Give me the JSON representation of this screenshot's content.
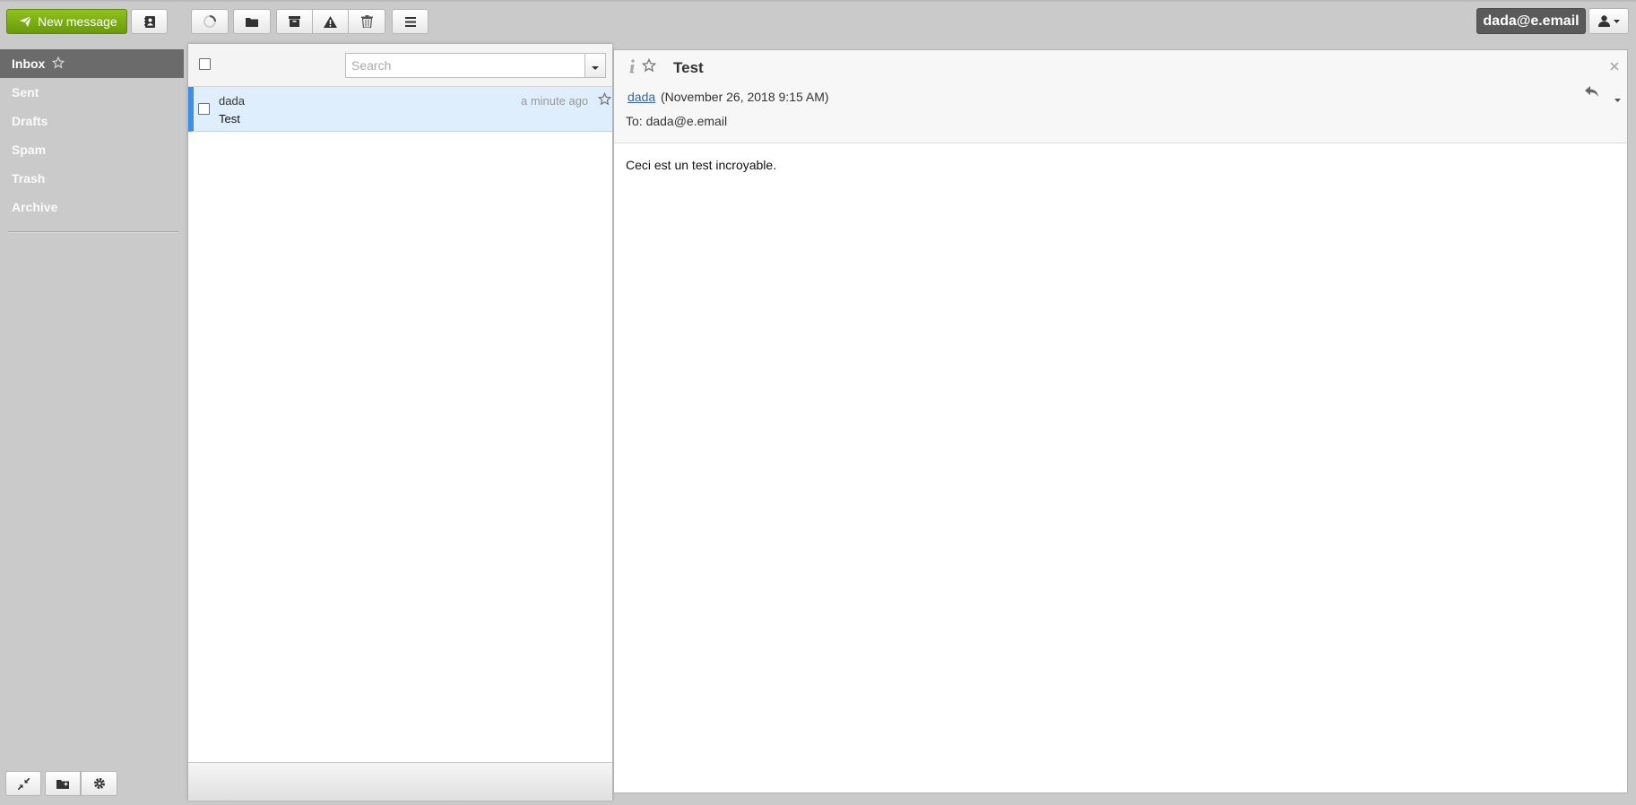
{
  "toolbar": {
    "new_message_label": "New message",
    "user_email": "dada@e.email"
  },
  "folders": [
    {
      "label": "Inbox",
      "active": true
    },
    {
      "label": "Sent"
    },
    {
      "label": "Drafts"
    },
    {
      "label": "Spam"
    },
    {
      "label": "Trash"
    },
    {
      "label": "Archive"
    }
  ],
  "search": {
    "placeholder": "Search"
  },
  "messages": [
    {
      "from": "dada",
      "subject": "Test",
      "date": "a minute ago",
      "selected": true
    }
  ],
  "reader": {
    "subject": "Test",
    "sender": "dada",
    "date": "(November 26, 2018 9:15 AM)",
    "to": "To: dada@e.email",
    "body": "Ceci est un test incroyable."
  },
  "colors": {
    "new_button": "#7cb014",
    "active_folder": "#6b6b6b",
    "selected_row": "#dfeefc",
    "selected_row_marker": "#3b8fe6",
    "sender_link": "#336699"
  }
}
